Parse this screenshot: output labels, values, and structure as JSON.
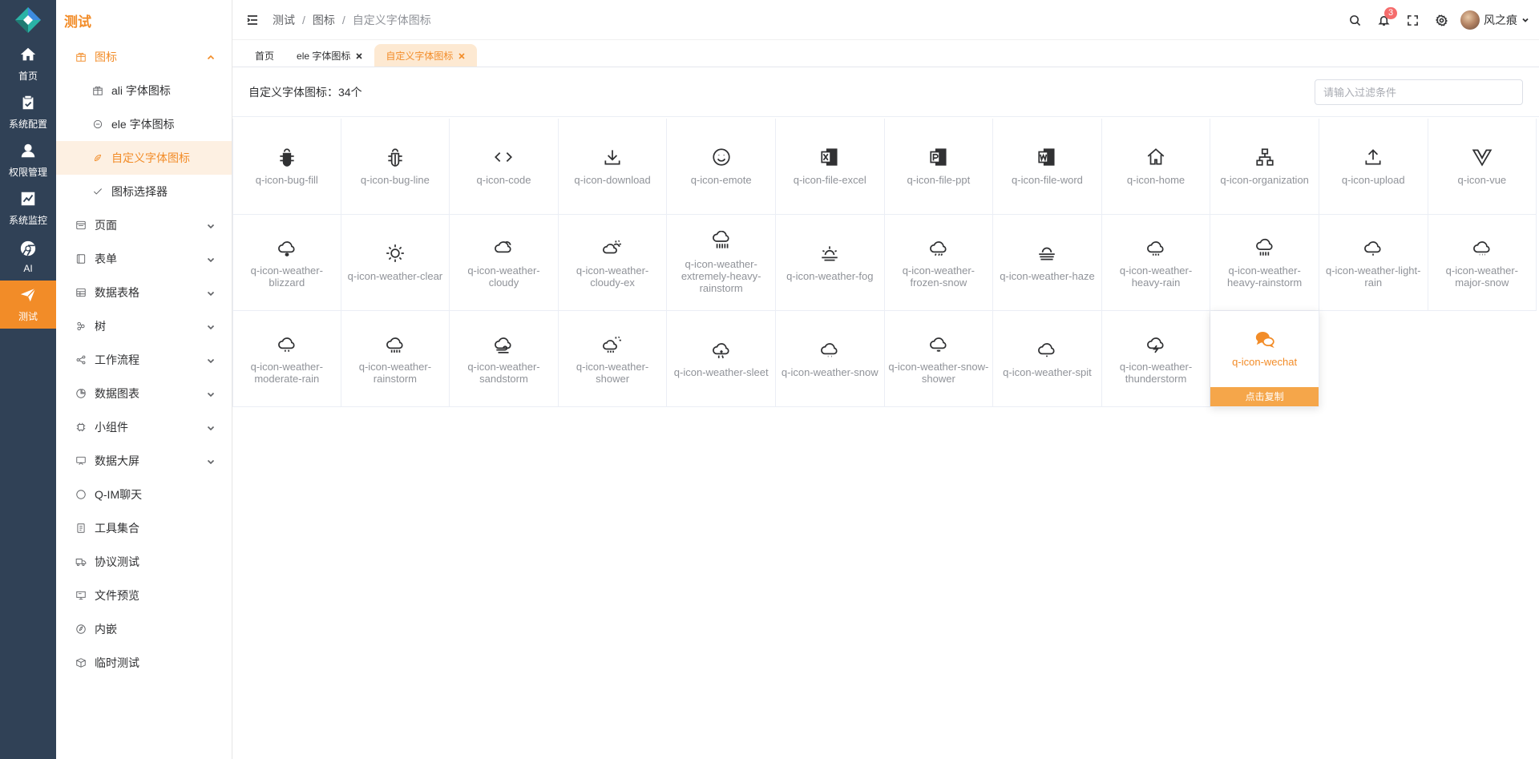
{
  "app": {
    "title": "测试",
    "accent": "#f28c28",
    "sidebar_bg": "#304156"
  },
  "rail": [
    {
      "label": "首页",
      "icon": "home-icon",
      "active": false
    },
    {
      "label": "系统配置",
      "icon": "clipboard-icon",
      "active": false
    },
    {
      "label": "权限管理",
      "icon": "user-icon",
      "active": false
    },
    {
      "label": "系统监控",
      "icon": "chart-icon",
      "active": false
    },
    {
      "label": "AI",
      "icon": "chrome-icon",
      "active": false
    },
    {
      "label": "测试",
      "icon": "send-icon",
      "active": true
    }
  ],
  "menu": {
    "title": "测试",
    "items": [
      {
        "label": "图标",
        "icon": "gift-icon",
        "open": true
      },
      {
        "label": "ali 字体图标",
        "icon": "gift-icon"
      },
      {
        "label": "ele 字体图标",
        "icon": "element-icon"
      },
      {
        "label": "自定义字体图标",
        "icon": "custom-icon"
      },
      {
        "label": "图标选择器",
        "icon": "check-icon"
      },
      {
        "label": "页面",
        "icon": "page-icon"
      },
      {
        "label": "表单",
        "icon": "form-icon"
      },
      {
        "label": "数据表格",
        "icon": "table-icon"
      },
      {
        "label": "树",
        "icon": "tree-icon"
      },
      {
        "label": "工作流程",
        "icon": "share-icon"
      },
      {
        "label": "数据图表",
        "icon": "pie-icon"
      },
      {
        "label": "小组件",
        "icon": "cpu-icon"
      },
      {
        "label": "数据大屏",
        "icon": "screen-icon"
      },
      {
        "label": "Q-IM聊天",
        "icon": "chat-icon"
      },
      {
        "label": "工具集合",
        "icon": "tickets-icon"
      },
      {
        "label": "协议测试",
        "icon": "van-icon"
      },
      {
        "label": "文件预览",
        "icon": "present-icon"
      },
      {
        "label": "内嵌",
        "icon": "compass-icon"
      },
      {
        "label": "临时测试",
        "icon": "box-icon"
      }
    ]
  },
  "header": {
    "breadcrumb": [
      "测试",
      "图标",
      "自定义字体图标"
    ],
    "notification_count": "3",
    "username": "风之痕"
  },
  "tabs": [
    {
      "label": "首页",
      "closable": false,
      "active": false
    },
    {
      "label": "ele 字体图标",
      "closable": true,
      "active": false
    },
    {
      "label": "自定义字体图标",
      "closable": true,
      "active": true
    }
  ],
  "content": {
    "count_label": "自定义字体图标：34个",
    "filter_placeholder": "请输入过滤条件",
    "copy_label": "点击复制",
    "icons": [
      "q-icon-bug-fill",
      "q-icon-bug-line",
      "q-icon-code",
      "q-icon-download",
      "q-icon-emote",
      "q-icon-file-excel",
      "q-icon-file-ppt",
      "q-icon-file-word",
      "q-icon-home",
      "q-icon-organization",
      "q-icon-upload",
      "q-icon-vue",
      "q-icon-weather-blizzard",
      "q-icon-weather-clear",
      "q-icon-weather-cloudy",
      "q-icon-weather-cloudy-ex",
      "q-icon-weather-extremely-heavy-rainstorm",
      "q-icon-weather-fog",
      "q-icon-weather-frozen-snow",
      "q-icon-weather-haze",
      "q-icon-weather-heavy-rain",
      "q-icon-weather-heavy-rainstorm",
      "q-icon-weather-light-rain",
      "q-icon-weather-major-snow",
      "q-icon-weather-moderate-rain",
      "q-icon-weather-rainstorm",
      "q-icon-weather-sandstorm",
      "q-icon-weather-shower",
      "q-icon-weather-sleet",
      "q-icon-weather-snow",
      "q-icon-weather-snow-shower",
      "q-icon-weather-spit",
      "q-icon-weather-thunderstorm",
      "q-icon-wechat"
    ],
    "hovered_icon": "q-icon-wechat"
  }
}
